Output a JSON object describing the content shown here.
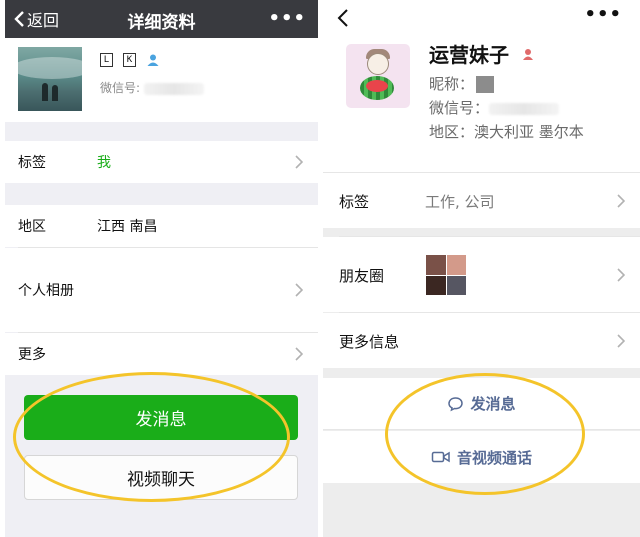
{
  "left": {
    "nav": {
      "back_label": "返回",
      "title": "详细资料",
      "more": "•••"
    },
    "profile": {
      "name_chars": [
        "L",
        "K"
      ],
      "wechat_id_label": "微信号:"
    },
    "rows": [
      {
        "label": "标签",
        "value": "我"
      },
      {
        "label": "地区",
        "value": "江西 南昌"
      },
      {
        "label": "个人相册",
        "value": ""
      },
      {
        "label": "更多",
        "value": ""
      }
    ],
    "buttons": {
      "send_message": "发消息",
      "video_chat": "视频聊天"
    },
    "colors": {
      "nav_bg": "#393a3f",
      "accent_green": "#1aad19"
    }
  },
  "right": {
    "nav": {
      "more": "•••"
    },
    "profile": {
      "name": "运营妹子",
      "nickname_label": "昵称：",
      "wechat_id_label": "微信号：",
      "region_label": "地区：",
      "region_value": "澳大利亚 墨尔本"
    },
    "rows": [
      {
        "label": "标签",
        "value": "工作, 公司"
      },
      {
        "label": "朋友圈",
        "value": ""
      },
      {
        "label": "更多信息",
        "value": ""
      }
    ],
    "actions": {
      "send_message": "发消息",
      "av_call": "音视频通话"
    },
    "colors": {
      "link_blue": "#576b95",
      "gender_icon": "#e06a6a"
    }
  },
  "annotation": {
    "highlight_color": "#f4c42a"
  }
}
